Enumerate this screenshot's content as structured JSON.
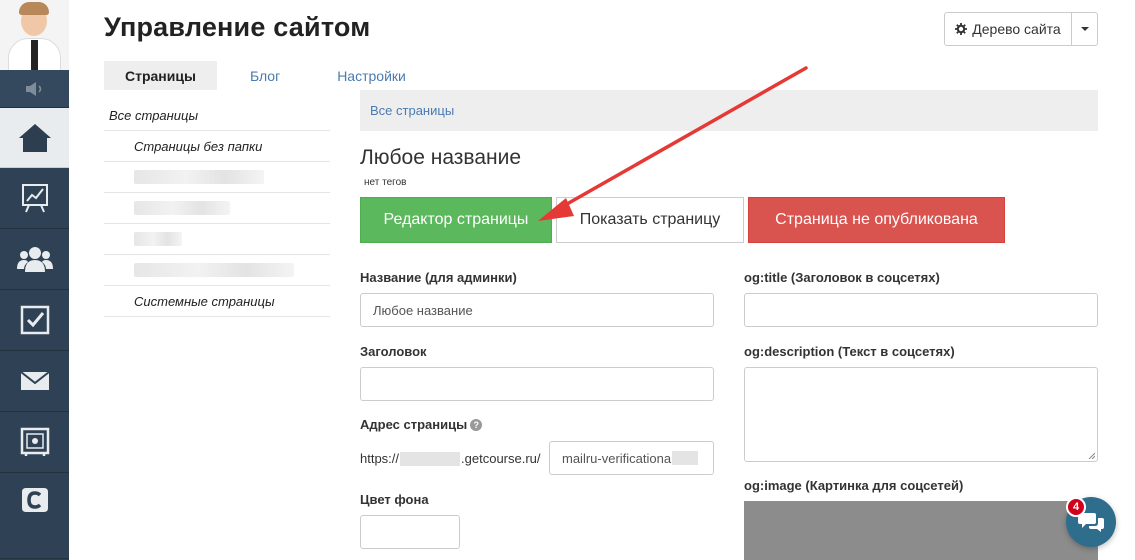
{
  "header": {
    "title": "Управление сайтом",
    "tree_button_label": "Дерево сайта"
  },
  "tabs": [
    {
      "label": "Страницы",
      "active": true
    },
    {
      "label": "Блог",
      "active": false
    },
    {
      "label": "Настройки",
      "active": false
    }
  ],
  "folders": {
    "all_pages": "Все страницы",
    "no_folder": "Страницы без папки",
    "system": "Системные страницы"
  },
  "sidebar": {
    "icons": [
      "speaker-icon",
      "home-icon",
      "chart-icon",
      "users-icon",
      "checkbox-icon",
      "mail-icon",
      "safe-icon",
      "getcourse-logo-icon"
    ]
  },
  "main": {
    "breadcrumb": "Все страницы",
    "page_name": "Любое название",
    "tags": "нет тегов",
    "buttons": {
      "editor": "Редактор страницы",
      "show": "Показать страницу",
      "unpublished": "Страница не опубликована"
    },
    "fields": {
      "admin_name_label": "Название (для админки)",
      "admin_name_value": "Любое название",
      "heading_label": "Заголовок",
      "heading_value": "",
      "address_label": "Адрес страницы",
      "address_prefix_start": "https://",
      "address_prefix_end": ".getcourse.ru/",
      "address_value": "mailru-verificationa",
      "bg_color_label": "Цвет фона",
      "og_title_label": "og:title (Заголовок в соцсетях)",
      "og_description_label": "og:description (Текст в соцсетях)",
      "og_image_label": "og:image (Картинка для соцсетей)"
    }
  },
  "chat": {
    "badge_count": "4"
  },
  "colors": {
    "sidebar": "#2c3e50",
    "green": "#5cb85c",
    "red": "#d9534f",
    "link": "#4a7bb0",
    "annotation_arrow": "#e53935"
  }
}
